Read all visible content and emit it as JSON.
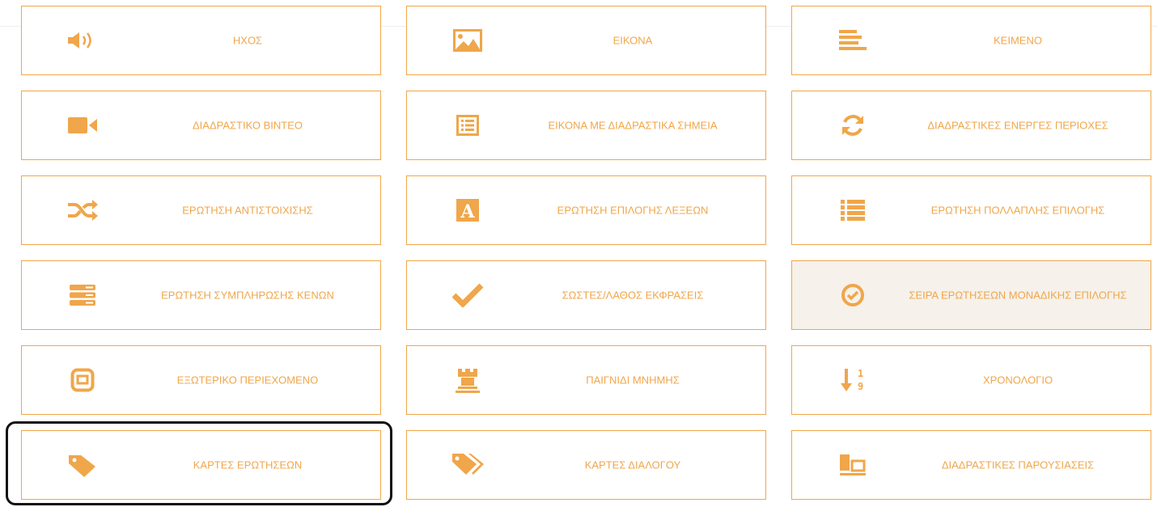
{
  "accent_color": "#f0a64a",
  "tiles": [
    {
      "label": "ΗΧΟΣ",
      "icon": "speaker-icon"
    },
    {
      "label": "ΕΙΚΟΝΑ",
      "icon": "image-icon"
    },
    {
      "label": "ΚΕΙΜΕΝΟ",
      "icon": "text-align-icon"
    },
    {
      "label": "ΔΙΑΔΡΑΣΤΙΚΟ ΒΙΝΤΕΟ",
      "icon": "video-camera-icon"
    },
    {
      "label": "ΕΙΚΟΝΑ ΜΕ ΔΙΑΔΡΑΣΤΙΚΑ ΣΗΜΕΙΑ",
      "icon": "list-box-icon"
    },
    {
      "label": "ΔΙΑΔΡΑΣΤΙΚΕΣ ΕΝΕΡΓΕΣ ΠΕΡΙΟΧΕΣ",
      "icon": "refresh-icon"
    },
    {
      "label": "ΕΡΩΤΗΣΗ ΑΝΤΙΣΤΟΙΧΙΣΗΣ",
      "icon": "shuffle-icon"
    },
    {
      "label": "ΕΡΩΤΗΣΗ ΕΠΙΛΟΓΗΣ ΛΕΞΕΩΝ",
      "icon": "font-a-icon"
    },
    {
      "label": "ΕΡΩΤΗΣΗ ΠΟΛΛΑΠΛΗΣ ΕΠΙΛΟΓΗΣ",
      "icon": "bullet-list-icon"
    },
    {
      "label": "ΕΡΩΤΗΣΗ ΣΥΜΠΛΗΡΩΣΗΣ ΚΕΝΩΝ",
      "icon": "fill-blanks-icon"
    },
    {
      "label": "ΣΩΣΤΕΣ/ΛΑΘΟΣ ΕΚΦΡΑΣΕΙΣ",
      "icon": "checkmark-icon"
    },
    {
      "label": "ΣΕΙΡΑ ΕΡΩΤΗΣΕΩΝ ΜΟΝΑΔΙΚΗΣ ΕΠΙΛΟΓΗΣ",
      "icon": "check-circle-icon",
      "highlighted": true
    },
    {
      "label": "ΕΞΩΤΕΡΙΚΟ ΠΕΡΙΕΧΟΜΕΝΟ",
      "icon": "embed-box-icon"
    },
    {
      "label": "ΠΑΙΓΝΙΔΙ ΜΝΗΜΗΣ",
      "icon": "rook-icon"
    },
    {
      "label": "ΧΡΟΝΟΛΟΓΙΟ",
      "icon": "sort-numeric-icon"
    },
    {
      "label": "ΚΑΡΤΕΣ ΕΡΩΤΗΣΕΩΝ",
      "icon": "tag-icon",
      "selected": true
    },
    {
      "label": "ΚΑΡΤΕΣ ΔΙΑΛΟΓΟΥ",
      "icon": "tags-icon"
    },
    {
      "label": "ΔΙΑΔΡΑΣΤΙΚΕΣ ΠΑΡΟΥΣΙΑΣΕΙΣ",
      "icon": "slides-icon"
    }
  ]
}
